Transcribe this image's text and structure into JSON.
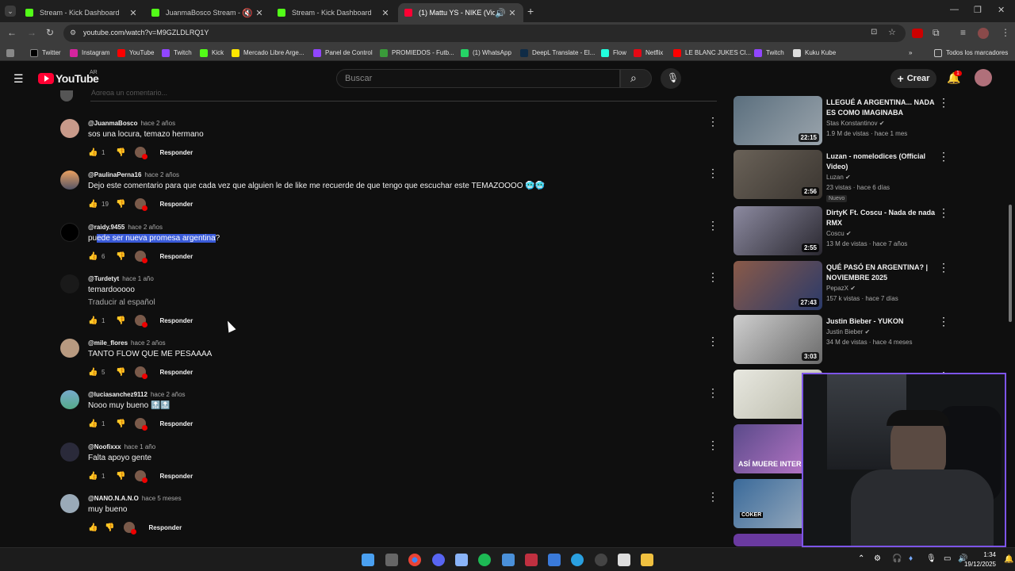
{
  "browser": {
    "tabs": [
      {
        "label": "Stream - Kick Dashboard",
        "fav": "#53fc18"
      },
      {
        "label": "JuanmaBosco Stream - Wat",
        "fav": "#53fc18"
      },
      {
        "label": "Stream - Kick Dashboard",
        "fav": "#53fc18"
      },
      {
        "label": "(1) Mattu YS - NIKE (Video",
        "fav": "#ff0033"
      }
    ],
    "url": "youtube.com/watch?v=M9GZLDLRQ1Y",
    "bookmarks": [
      "Twitter",
      "Instagram",
      "YouTube",
      "Twitch",
      "Kick",
      "Mercado Libre Arge...",
      "Panel de Control",
      "PROMIEDOS - Futb...",
      "(1) WhatsApp",
      "DeepL Translate - El...",
      "Flow",
      "Netflix",
      "LE BLANC JUKES Cl...",
      "Twitch",
      "Kuku Kube"
    ],
    "all_bookmarks": "Todos los marcadores"
  },
  "youtube": {
    "logo": "YouTube",
    "region": "AR",
    "search_placeholder": "Buscar",
    "create_label": "Crear",
    "notif_count": "1",
    "add_comment_placeholder": "Agrega un comentario..."
  },
  "comments": [
    {
      "author": "@JuanmaBosco",
      "time": "hace 2 años",
      "text": "sos una locura, temazo hermano",
      "likes": "1",
      "reply": "Responder"
    },
    {
      "author": "@PaulinaPerna16",
      "time": "hace 2 años",
      "text": "Dejo este comentario para que cada vez que alguien le de like me recuerde de que tengo que escuchar este TEMAZOOOO 🥶🥶",
      "likes": "19",
      "reply": "Responder"
    },
    {
      "author": "@raidy.9455",
      "time": "hace 2 años",
      "text_pre": "pu",
      "text_hl": "ede ser nueva promesa argentina",
      "text_post": "?",
      "likes": "6",
      "reply": "Responder"
    },
    {
      "author": "@Turdetyt",
      "time": "hace 1 año",
      "text": "temardooooo",
      "translate": "Traducir al español",
      "likes": "1",
      "reply": "Responder"
    },
    {
      "author": "@mile_flores",
      "time": "hace 2 años",
      "text": "TANTO FLOW QUE ME PESAAAA",
      "likes": "5",
      "reply": "Responder"
    },
    {
      "author": "@luciasanchez9112",
      "time": "hace 2 años",
      "text": "Nooo muy bueno 🔝🔝",
      "likes": "1",
      "reply": "Responder"
    },
    {
      "author": "@Noofixxx",
      "time": "hace 1 año",
      "text": "Falta apoyo gente",
      "likes": "1",
      "reply": "Responder"
    },
    {
      "author": "@NANO.N.A.N.O",
      "time": "hace 5 meses",
      "text": "muy bueno",
      "likes": "",
      "reply": "Responder"
    }
  ],
  "side_videos": [
    {
      "title": "LLEGUÉ A ARGENTINA... NADA ES COMO IMAGINABA",
      "channel": "Stas Konstantinov",
      "meta": "1.9 M de vistas · hace 1 mes",
      "duration": "22:15",
      "thumb": "#5b6f7e"
    },
    {
      "title": "Luzan - nomelodices (Official Video)",
      "channel": "Luzan",
      "meta": "23 vistas · hace 6 días",
      "duration": "2:56",
      "badge": "Nuevo",
      "thumb": "#6a6258"
    },
    {
      "title": "DirtyK Ft. Coscu - Nada de nada RMX",
      "channel": "Coscu",
      "meta": "13 M de vistas · hace 7 años",
      "duration": "2:55",
      "thumb": "#8c8aa0"
    },
    {
      "title": "QUÉ PASÓ EN ARGENTINA? | NOVIEMBRE 2025",
      "channel": "PepazX",
      "meta": "157 k vistas · hace 7 días",
      "duration": "27:43",
      "thumb": "#8a5a48"
    },
    {
      "title": "Justin Bieber - YUKON",
      "channel": "Justin Bieber",
      "meta": "34 M de vistas · hace 4 meses",
      "duration": "3:03",
      "thumb": "#9a9a9a"
    },
    {
      "title": "",
      "channel": "",
      "meta": "",
      "duration": "",
      "thumb": "#d8d8d0"
    },
    {
      "title": "",
      "channel": "",
      "meta": "",
      "duration": "",
      "thumb": "#5a4a8a",
      "overlay": "ASÍ MUERE INTER"
    },
    {
      "title": "",
      "channel": "",
      "meta": "",
      "duration": "",
      "thumb": "#3a6a9a",
      "overlay": "COKER"
    }
  ],
  "taskbar": {
    "time": "1:34",
    "date": "19/12/2025"
  }
}
